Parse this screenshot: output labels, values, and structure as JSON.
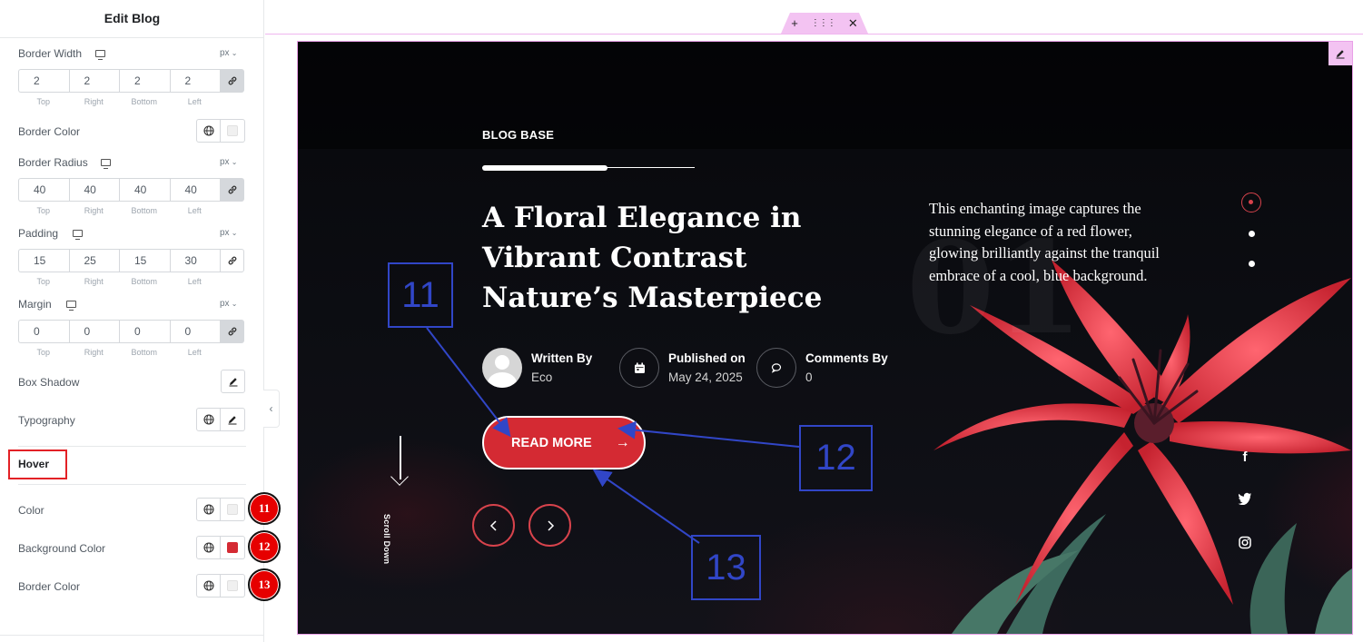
{
  "panel": {
    "title": "Edit Blog",
    "border_width": {
      "label": "Border Width",
      "unit": "px",
      "values": [
        "2",
        "2",
        "2",
        "2"
      ]
    },
    "border_color_label": "Border Color",
    "border_radius": {
      "label": "Border Radius",
      "unit": "px",
      "values": [
        "40",
        "40",
        "40",
        "40"
      ]
    },
    "padding": {
      "label": "Padding",
      "unit": "px",
      "values": [
        "15",
        "25",
        "15",
        "30"
      ]
    },
    "margin": {
      "label": "Margin",
      "unit": "px",
      "values": [
        "0",
        "0",
        "0",
        "0"
      ]
    },
    "sides": [
      "Top",
      "Right",
      "Bottom",
      "Left"
    ],
    "box_shadow_label": "Box Shadow",
    "typography_label": "Typography",
    "hover_tab": "Hover",
    "hover": {
      "color_label": "Color",
      "background_color_label": "Background Color",
      "border_color_label": "Border Color",
      "background_swatch": "#d42a33"
    },
    "badges": [
      "11",
      "12",
      "13"
    ]
  },
  "hero": {
    "eyebrow": "BLOG BASE",
    "title": "A Floral Elegance in Vibrant Contrast Nature’s Masterpiece",
    "description": "This enchanting image captures the stunning elegance of a red flower, glowing brilliantly against the tranquil embrace of a cool, blue background.",
    "ghost_number": "01",
    "meta": {
      "author_label": "Written By",
      "author": "Eco",
      "published_label": "Published on",
      "published": "May 24, 2025",
      "comments_label": "Comments By",
      "comments": "0"
    },
    "read_more": "READ MORE",
    "scroll_down": "Scroll Down",
    "accent": "#d42a33"
  },
  "annotations": [
    "11",
    "12",
    "13"
  ]
}
